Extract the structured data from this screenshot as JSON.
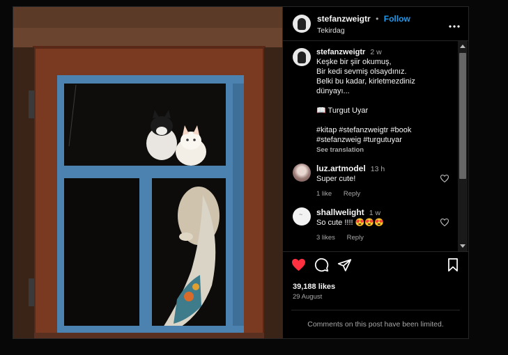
{
  "post": {
    "username": "stefanzweigtr",
    "separator": "•",
    "follow_label": "Follow",
    "location": "Tekirdag",
    "more_label": "•••"
  },
  "caption": {
    "username": "stefanzweigtr",
    "time": "2 w",
    "lines": [
      "Keşke bir şiir okumuş,",
      "Bir kedi sevmiş olsaydınız.",
      "Belki bu kadar, kirletmezdiniz",
      "dünyayı..."
    ],
    "author": "📖 Turgut Uyar",
    "hashtags_line1": "#kitap #stefanzweigtr #book",
    "hashtags_line2": "#stefanzweig #turgutuyar",
    "see_translation": "See translation"
  },
  "comments": [
    {
      "username": "luz.artmodel",
      "time": "13 h",
      "text": "Super cute!",
      "likes": "1 like",
      "reply": "Reply"
    },
    {
      "username": "shallwelight",
      "time": "1 w",
      "text": "So cute !!!! 😍😍😍",
      "likes": "3 likes",
      "reply": "Reply"
    }
  ],
  "stats": {
    "likes": "39,188 likes",
    "date": "29 August",
    "liked": true
  },
  "comments_limited": "Comments on this post have been limited.",
  "colors": {
    "follow": "#1d9bf0",
    "heart": "#ff3040",
    "background": "#000000"
  }
}
